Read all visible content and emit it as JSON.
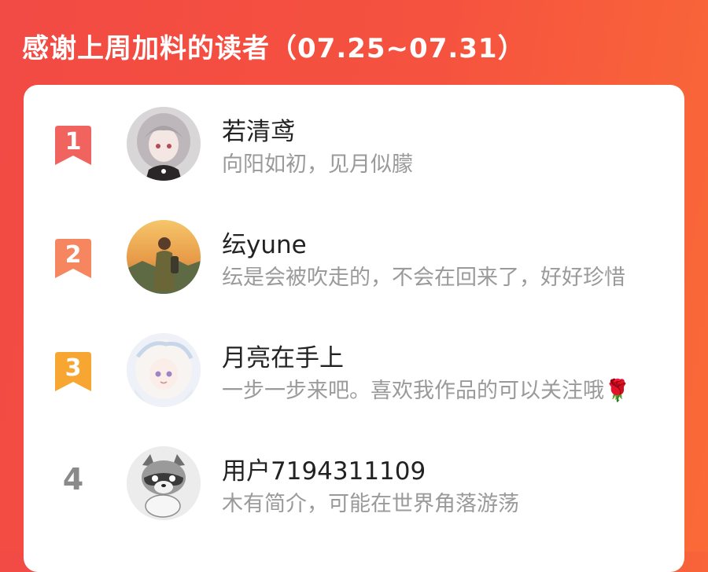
{
  "header": {
    "title": "感谢上周加料的读者（07.25~07.31）"
  },
  "colors": {
    "background": "#f24a44",
    "rank1": "#f0635e",
    "rank2": "#f5865f",
    "rank3": "#f7a632",
    "rank_plain": "#8a8a8a"
  },
  "readers": [
    {
      "rank": "1",
      "name": "若清鸢",
      "bio": "向阳如初，见月似朦",
      "avatar_icon": "avatar-anime-girl-icon"
    },
    {
      "rank": "2",
      "name": "纭yune",
      "bio": "纭是会被吹走的，不会在回来了，好好珍惜",
      "avatar_icon": "avatar-sunset-traveler-icon"
    },
    {
      "rank": "3",
      "name": "月亮在手上",
      "bio": "一步一步来吧。喜欢我作品的可以关注哦🌹",
      "avatar_icon": "avatar-anime-white-hair-icon"
    },
    {
      "rank": "4",
      "name": "用户7194311109",
      "bio": "木有简介，可能在世界角落游荡",
      "avatar_icon": "avatar-raccoon-icon"
    }
  ]
}
